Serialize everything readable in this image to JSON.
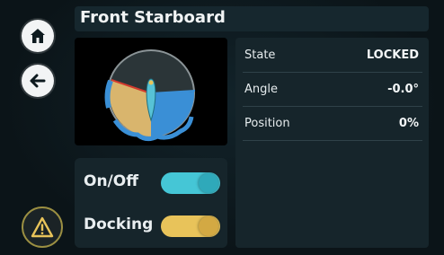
{
  "title": "Front Starboard",
  "nav": {
    "home_icon": "home-icon",
    "back_icon": "arrow-left-icon",
    "warning_icon": "warning-triangle-icon"
  },
  "switches": [
    {
      "label": "On/Off",
      "state": "on",
      "color": "#45c6d6"
    },
    {
      "label": "Docking",
      "state": "on",
      "color": "#e8c35a"
    }
  ],
  "info": [
    {
      "key": "State",
      "value": "LOCKED"
    },
    {
      "key": "Angle",
      "value": "-0.0°"
    },
    {
      "key": "Position",
      "value": "0%"
    }
  ],
  "colors": {
    "accent_cyan": "#45c6d6",
    "accent_yellow": "#e8c35a",
    "gauge_blue": "#3a8fd6",
    "gauge_tan": "#d9b56d",
    "gauge_red": "#d13a2e"
  }
}
